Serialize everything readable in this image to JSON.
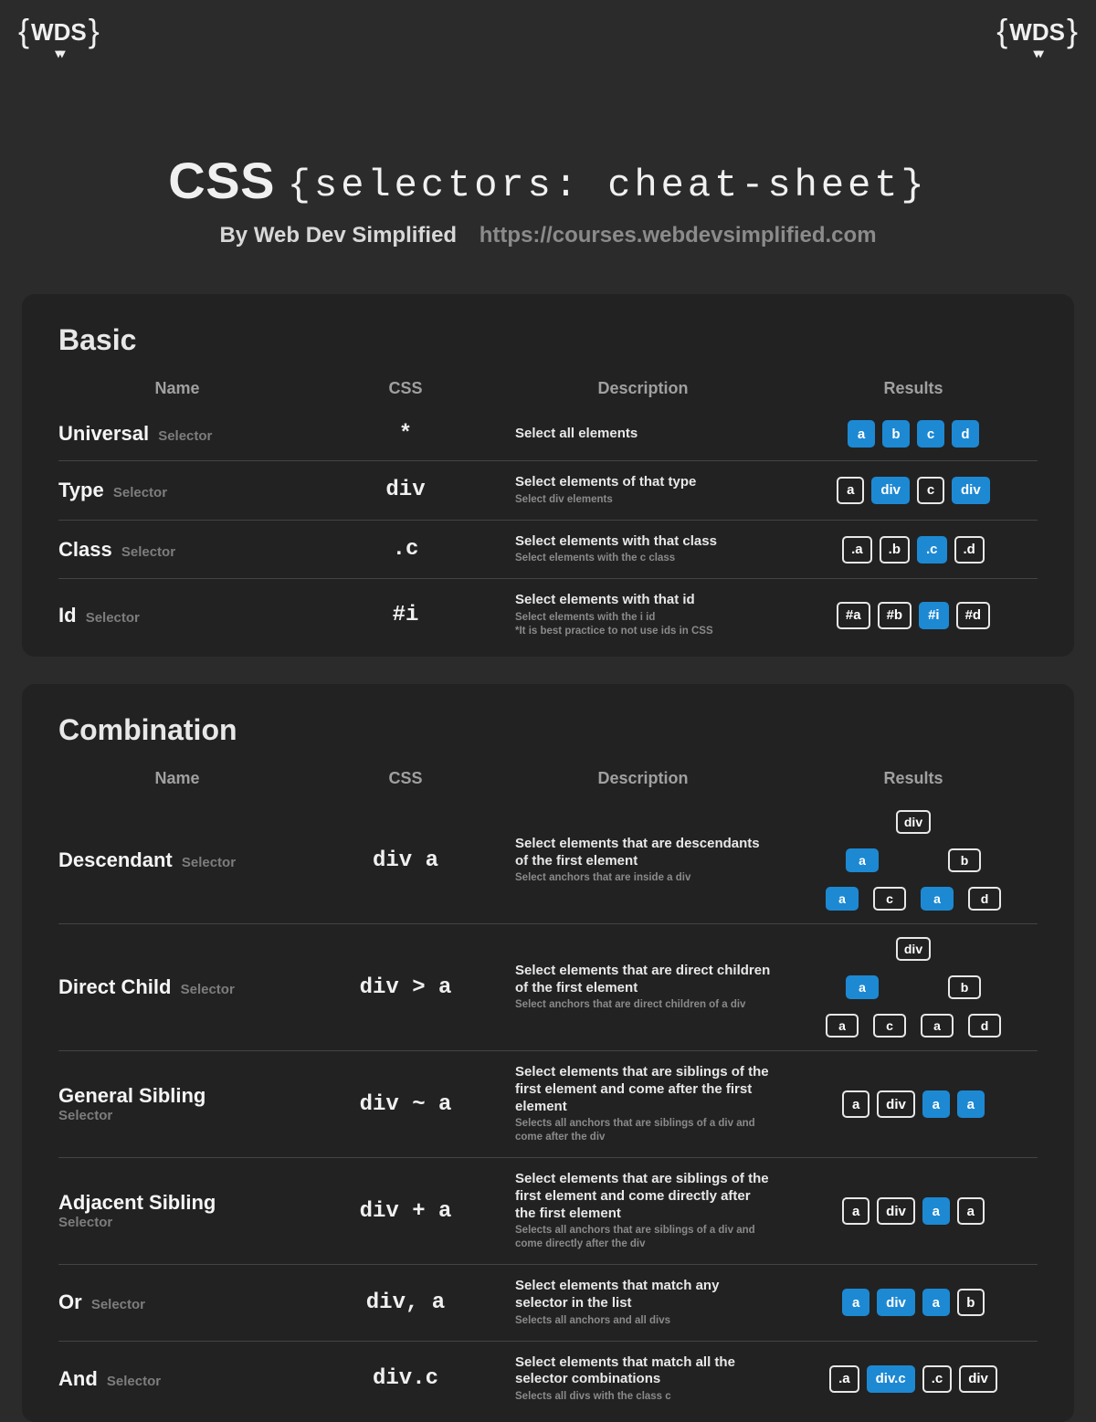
{
  "brand": "WDS",
  "header": {
    "title_bold": "CSS",
    "title_mono": "{selectors: cheat-sheet}",
    "by": "By Web Dev Simplified",
    "url": "https://courses.webdevsimplified.com"
  },
  "columns": {
    "name": "Name",
    "css": "CSS",
    "desc": "Description",
    "results": "Results"
  },
  "suffix": "Selector",
  "sections": [
    {
      "title": "Basic",
      "rows": [
        {
          "name": "Universal",
          "css": "*",
          "desc": "Select all elements",
          "sub": "",
          "results": [
            {
              "t": "a",
              "sel": true
            },
            {
              "t": "b",
              "sel": true
            },
            {
              "t": "c",
              "sel": true
            },
            {
              "t": "d",
              "sel": true
            }
          ]
        },
        {
          "name": "Type",
          "css": "div",
          "desc": "Select elements of that type",
          "sub": "Select div elements",
          "results": [
            {
              "t": "a",
              "sel": false
            },
            {
              "t": "div",
              "sel": true
            },
            {
              "t": "c",
              "sel": false
            },
            {
              "t": "div",
              "sel": true
            }
          ]
        },
        {
          "name": "Class",
          "css": ".c",
          "desc": "Select elements with that class",
          "sub": "Select elements with the c class",
          "results": [
            {
              "t": ".a",
              "sel": false
            },
            {
              "t": ".b",
              "sel": false
            },
            {
              "t": ".c",
              "sel": true
            },
            {
              "t": ".d",
              "sel": false
            }
          ]
        },
        {
          "name": "Id",
          "css": "#i",
          "desc": "Select elements with that id",
          "sub": "Select elements with the i id\n*It is best practice to not use ids in CSS",
          "results": [
            {
              "t": "#a",
              "sel": false
            },
            {
              "t": "#b",
              "sel": false
            },
            {
              "t": "#i",
              "sel": true
            },
            {
              "t": "#d",
              "sel": false
            }
          ]
        }
      ]
    },
    {
      "title": "Combination",
      "rows": [
        {
          "name": "Descendant",
          "css": "div a",
          "desc": "Select elements that are descendants of the first element",
          "sub": "Select anchors that are inside a div",
          "tree": {
            "root": {
              "t": "div",
              "sel": false
            },
            "l2": [
              {
                "t": "a",
                "sel": true
              },
              {
                "t": "b",
                "sel": false
              }
            ],
            "l3": [
              {
                "t": "a",
                "sel": true
              },
              {
                "t": "c",
                "sel": false
              },
              {
                "t": "a",
                "sel": true
              },
              {
                "t": "d",
                "sel": false
              }
            ]
          }
        },
        {
          "name": "Direct Child",
          "css": "div > a",
          "desc": "Select elements that are direct children of the first element",
          "sub": "Select anchors that are direct children of a div",
          "tree": {
            "root": {
              "t": "div",
              "sel": false
            },
            "l2": [
              {
                "t": "a",
                "sel": true
              },
              {
                "t": "b",
                "sel": false
              }
            ],
            "l3": [
              {
                "t": "a",
                "sel": false
              },
              {
                "t": "c",
                "sel": false
              },
              {
                "t": "a",
                "sel": false
              },
              {
                "t": "d",
                "sel": false
              }
            ]
          }
        },
        {
          "name": "General Sibling",
          "tall": true,
          "css": "div ~ a",
          "desc": "Select elements that are siblings of the first element and come after the first element",
          "sub": "Selects all anchors that are siblings of a div and come after the div",
          "results": [
            {
              "t": "a",
              "sel": false
            },
            {
              "t": "div",
              "sel": false
            },
            {
              "t": "a",
              "sel": true
            },
            {
              "t": "a",
              "sel": true
            }
          ]
        },
        {
          "name": "Adjacent Sibling",
          "tall": true,
          "css": "div + a",
          "desc": "Select elements that are siblings of the first element and come directly after the first element",
          "sub": "Selects all anchors that are siblings of a div and come directly after the div",
          "results": [
            {
              "t": "a",
              "sel": false
            },
            {
              "t": "div",
              "sel": false
            },
            {
              "t": "a",
              "sel": true
            },
            {
              "t": "a",
              "sel": false
            }
          ]
        },
        {
          "name": "Or",
          "css": "div, a",
          "desc": "Select elements that match any selector in the list",
          "sub": "Selects all anchors and all divs",
          "results": [
            {
              "t": "a",
              "sel": true
            },
            {
              "t": "div",
              "sel": true
            },
            {
              "t": "a",
              "sel": true
            },
            {
              "t": "b",
              "sel": false
            }
          ]
        },
        {
          "name": "And",
          "css": "div.c",
          "desc": "Select elements that match all the selector combinations",
          "sub": "Selects all divs with the class c",
          "results": [
            {
              "t": ".a",
              "sel": false
            },
            {
              "t": "div.c",
              "sel": true
            },
            {
              "t": ".c",
              "sel": false
            },
            {
              "t": "div",
              "sel": false
            }
          ]
        }
      ]
    }
  ]
}
